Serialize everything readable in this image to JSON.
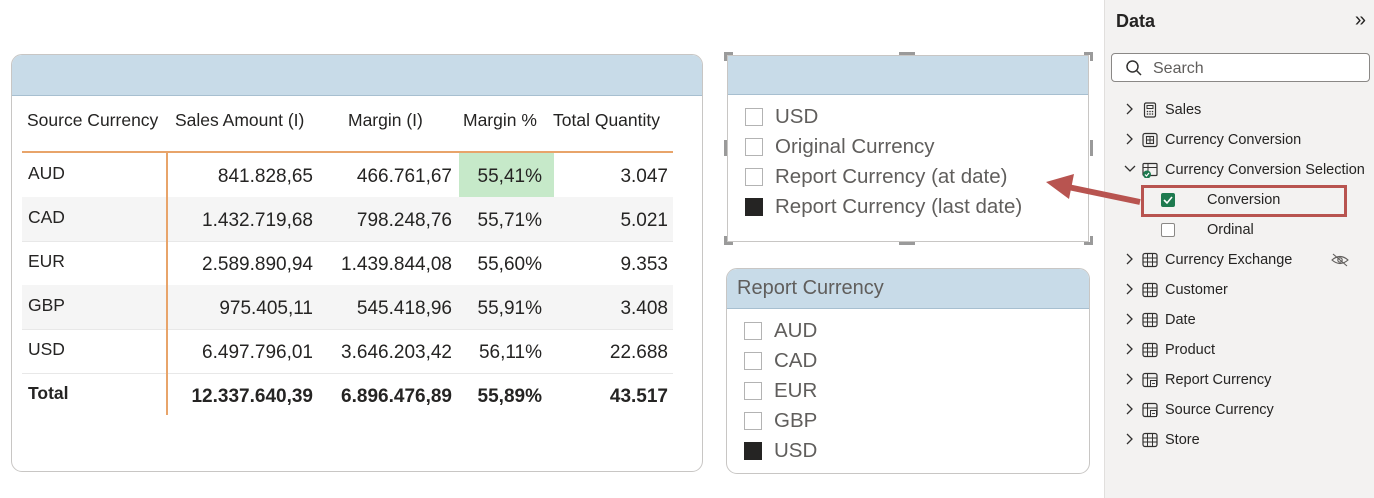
{
  "table": {
    "headers": [
      "Source Currency",
      "Sales Amount (I)",
      "Margin (I)",
      "Margin %",
      "Total Quantity"
    ],
    "rows": [
      [
        "AUD",
        "841.828,65",
        "466.761,67",
        "55,41%",
        "3.047"
      ],
      [
        "CAD",
        "1.432.719,68",
        "798.248,76",
        "55,71%",
        "5.021"
      ],
      [
        "EUR",
        "2.589.890,94",
        "1.439.844,08",
        "55,60%",
        "9.353"
      ],
      [
        "GBP",
        "975.405,11",
        "545.418,96",
        "55,91%",
        "3.408"
      ],
      [
        "USD",
        "6.497.796,01",
        "3.646.203,42",
        "56,11%",
        "22.688"
      ]
    ],
    "total": [
      "Total",
      "12.337.640,39",
      "6.896.476,89",
      "55,89%",
      "43.517"
    ],
    "highlight_color": "#c6e9c9"
  },
  "slicer_conversion": {
    "options": [
      {
        "label": "USD",
        "checked": false
      },
      {
        "label": "Original Currency",
        "checked": false
      },
      {
        "label": "Report Currency (at date)",
        "checked": false
      },
      {
        "label": "Report Currency (last date)",
        "checked": true
      }
    ]
  },
  "slicer_report_currency": {
    "title": "Report Currency",
    "options": [
      {
        "label": "AUD",
        "checked": false
      },
      {
        "label": "CAD",
        "checked": false
      },
      {
        "label": "EUR",
        "checked": false
      },
      {
        "label": "GBP",
        "checked": false
      },
      {
        "label": "USD",
        "checked": true
      }
    ]
  },
  "data_pane": {
    "title": "Data",
    "search_placeholder": "Search",
    "items": [
      {
        "label": "Sales",
        "icon": "calculator-icon"
      },
      {
        "label": "Currency Conversion",
        "icon": "parameter-table-icon"
      },
      {
        "label": "Currency Conversion Selection",
        "icon": "field-parameter-icon",
        "expanded": true
      },
      {
        "label": "Currency Exchange",
        "icon": "table-icon",
        "hidden": true
      },
      {
        "label": "Customer",
        "icon": "table-icon"
      },
      {
        "label": "Date",
        "icon": "table-icon"
      },
      {
        "label": "Product",
        "icon": "table-icon"
      },
      {
        "label": "Report Currency",
        "icon": "calc-table-icon"
      },
      {
        "label": "Source Currency",
        "icon": "calc-table-icon"
      },
      {
        "label": "Store",
        "icon": "table-icon"
      }
    ],
    "subitems": [
      {
        "label": "Conversion",
        "checked": true
      },
      {
        "label": "Ordinal",
        "checked": false
      }
    ]
  },
  "colors": {
    "header_band": "#c8dbe8",
    "accent_orange": "#e8a46a",
    "annotation_red": "#b85450",
    "check_green": "#1e7a4f"
  }
}
